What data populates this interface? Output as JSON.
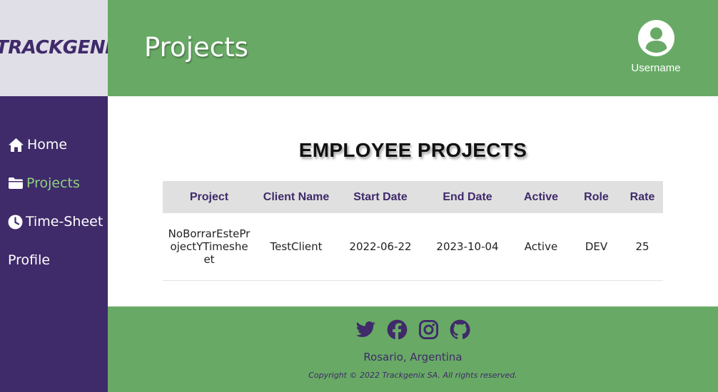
{
  "brand": {
    "logo_text": "TRACKGENIX"
  },
  "header": {
    "title": "Projects",
    "username": "Username"
  },
  "sidebar": {
    "items": [
      {
        "label": "Home",
        "icon": "home-icon"
      },
      {
        "label": "Projects",
        "icon": "folder-icon",
        "active": true
      },
      {
        "label": "Time-Sheet",
        "icon": "clock-icon"
      },
      {
        "label": "Profile"
      }
    ]
  },
  "main": {
    "section_title": "EMPLOYEE PROJECTS",
    "table": {
      "headers": [
        "Project",
        "Client Name",
        "Start Date",
        "End Date",
        "Active",
        "Role",
        "Rate"
      ],
      "rows": [
        [
          "NoBorrarEsteProjectYTimesheet",
          "TestClient",
          "2022-06-22",
          "2023-10-04",
          "Active",
          "DEV",
          "25"
        ]
      ]
    }
  },
  "footer": {
    "socials": [
      "twitter-icon",
      "facebook-icon",
      "instagram-icon",
      "github-icon"
    ],
    "location": "Rosario, Argentina",
    "copyright": "Copyright © 2022 Trackgenix SA. All rights reserved."
  },
  "colors": {
    "brand_green": "#68aa65",
    "brand_purple": "#3f2a6a",
    "active_link": "#8fd07f",
    "logo_bg": "#e0dfe7"
  }
}
